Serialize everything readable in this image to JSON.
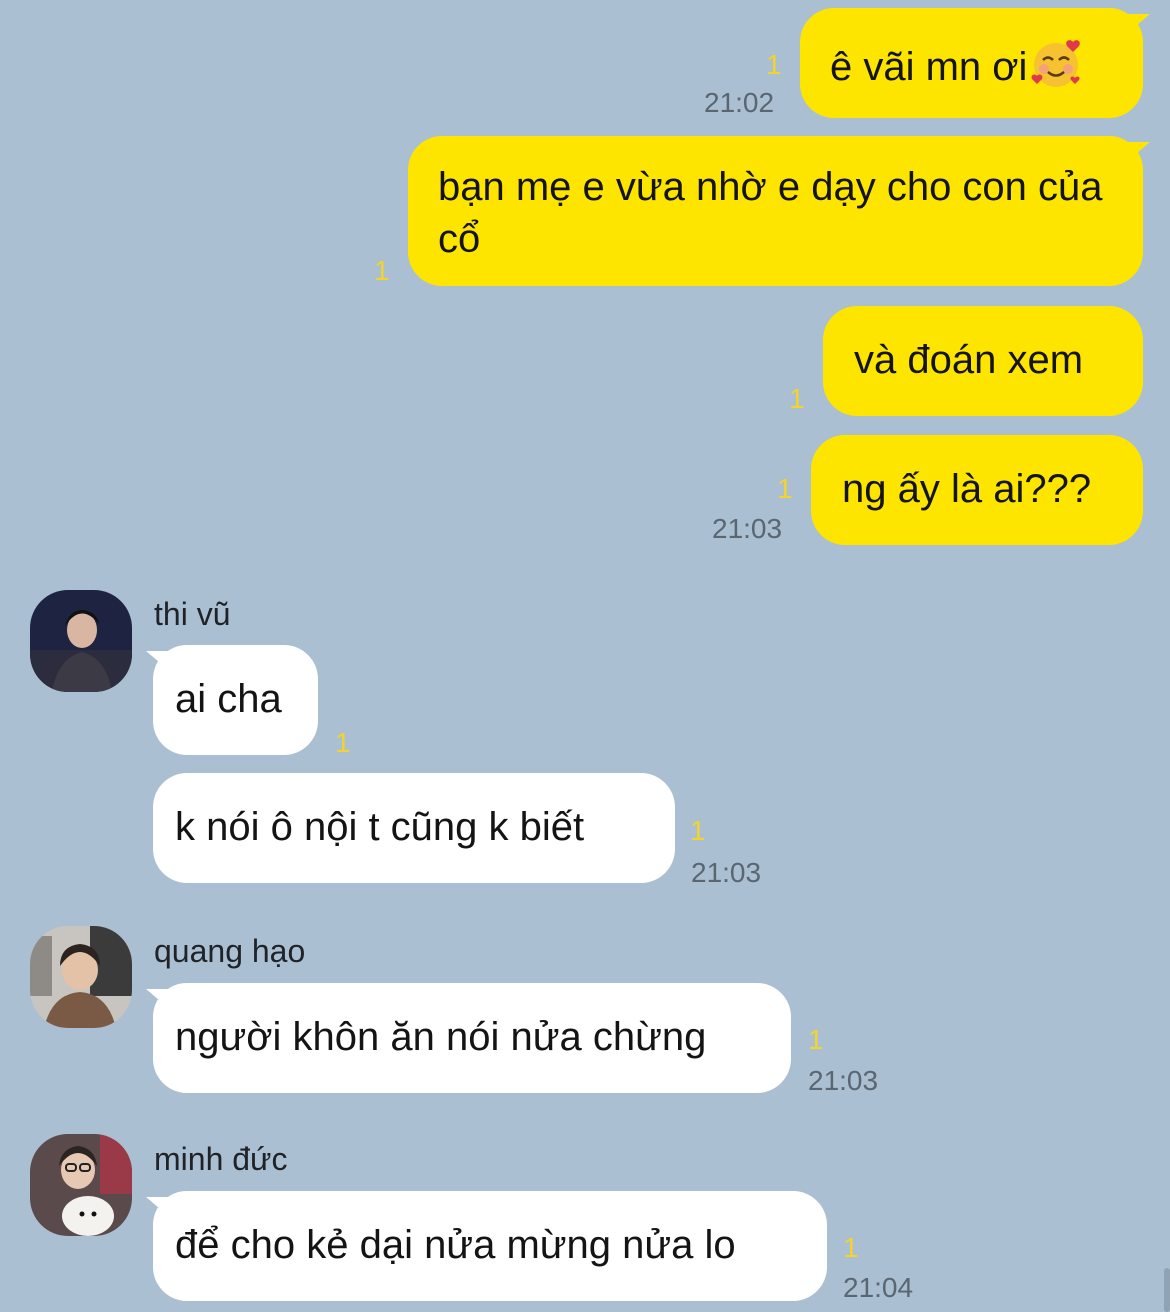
{
  "outgoing": [
    {
      "text": "ê vãi mn ơi",
      "emoji": "smiling-face-with-hearts",
      "unread": "1",
      "time": "21:02"
    },
    {
      "text": "bạn mẹ e vừa nhờ e dạy cho con của cổ",
      "unread": "1"
    },
    {
      "text": "và đoán xem",
      "unread": "1"
    },
    {
      "text": "ng ấy là ai???",
      "unread": "1",
      "time": "21:03"
    }
  ],
  "groups": [
    {
      "sender": "thi vũ",
      "messages": [
        {
          "text": "ai cha",
          "unread": "1"
        },
        {
          "text": "k nói ô nội t cũng k biết",
          "unread": "1",
          "time": "21:03"
        }
      ]
    },
    {
      "sender": "quang hạo",
      "messages": [
        {
          "text": "người khôn ăn nói nửa chừng",
          "unread": "1",
          "time": "21:03"
        }
      ]
    },
    {
      "sender": "minh đức",
      "messages": [
        {
          "text": "để cho kẻ dại nửa mừng nửa lo",
          "unread": "1",
          "time": "21:04"
        }
      ]
    }
  ],
  "colors": {
    "background": "#aabfd1",
    "my_bubble": "#fee500",
    "their_bubble": "#ffffff",
    "unread_count": "#f3d32c",
    "timestamp": "#5a6672"
  }
}
